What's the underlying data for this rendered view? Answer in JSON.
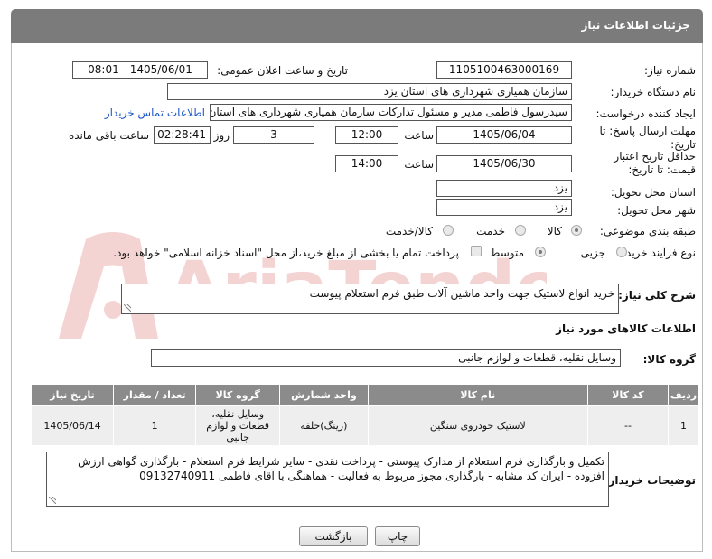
{
  "header": {
    "title": "جزئیات اطلاعات نیاز"
  },
  "labels": {
    "need_number": "شماره نیاز:",
    "announce_datetime": "تاریخ و ساعت اعلان عمومی:",
    "buyer_org": "نام دستگاه خریدار:",
    "requester": "ایجاد کننده درخواست:",
    "reply_deadline": "مهلت ارسال پاسخ: تا تاریخ:",
    "price_validity": "حداقل تاریخ اعتبار قیمت: تا تاریخ:",
    "delivery_province": "استان محل تحویل:",
    "delivery_city": "شهر محل تحویل:",
    "category": "طبقه بندی موضوعی:",
    "purchase_type": "نوع فرآیند خرید :",
    "hour": "ساعت",
    "day_and": "روز و",
    "remaining": "ساعت باقی مانده",
    "general_desc": "شرح کلی نیاز:",
    "goods_info": "اطلاعات کالاهای مورد نیاز",
    "goods_group": "گروه کالا:",
    "buyer_notes": "توضیحات خریدار:"
  },
  "fields": {
    "need_number": "1105100463000169",
    "announce_datetime": "1405/06/01 - 08:01",
    "buyer_org": "سازمان همیاری شهرداری های استان یزد",
    "requester": "سیدرسول فاطمی مدیر و مسئول تدارکات سازمان همیاری شهرداری های استان یزد",
    "contact_link": "اطلاعات تماس خریدار",
    "reply_date": "1405/06/04",
    "reply_time": "12:00",
    "reply_days": "3",
    "reply_remaining": "02:28:41",
    "validity_date": "1405/06/30",
    "validity_time": "14:00",
    "delivery_province": "یزد",
    "delivery_city": "یزد",
    "general_desc": "خرید انواع لاستیک جهت واحد ماشین آلات طبق فرم استعلام پیوست",
    "goods_group": "وسایل نقلیه، قطعات و لوازم جانبی",
    "buyer_notes": "تکمیل و بارگذاری فرم استعلام از مدارک پیوستی - پرداخت نقدی - سایر شرایط فرم استعلام - بارگذاری گواهی ارزش افزوده - ایران کد مشابه - بارگذاری مجوز مربوط به فعالیت - هماهنگی با آقای فاطمی 09132740911"
  },
  "category_options": {
    "goods": "کالا",
    "service": "خدمت",
    "goods_service": "کالا/خدمت",
    "selected": "goods"
  },
  "purchase_options": {
    "minor": "جزیی",
    "medium": "متوسط",
    "selected": "medium",
    "payment_note": "پرداخت تمام یا بخشی از مبلغ خرید،از محل \"اسناد خزانه اسلامی\" خواهد بود."
  },
  "table": {
    "headers": [
      "ردیف",
      "کد کالا",
      "نام کالا",
      "واحد شمارش",
      "گروه کالا",
      "تعداد / مقدار",
      "تاریخ نیاز"
    ],
    "rows": [
      {
        "row": "1",
        "code": "--",
        "name": "لاستیک خودروی سنگین",
        "unit": "(رینگ)حلقه",
        "group": "وسایل نقلیه، قطعات و لوازم جانبی",
        "qty": "1",
        "date": "1405/06/14"
      }
    ]
  },
  "buttons": {
    "back": "بازگشت",
    "print": "چاپ"
  },
  "watermark": {
    "text": "AriaTender.net"
  },
  "colors": {
    "header_bg": "#7b7b7b",
    "table_header_bg": "#8b8b8b",
    "link": "#1a57c4",
    "watermark": "#d23b3b"
  }
}
